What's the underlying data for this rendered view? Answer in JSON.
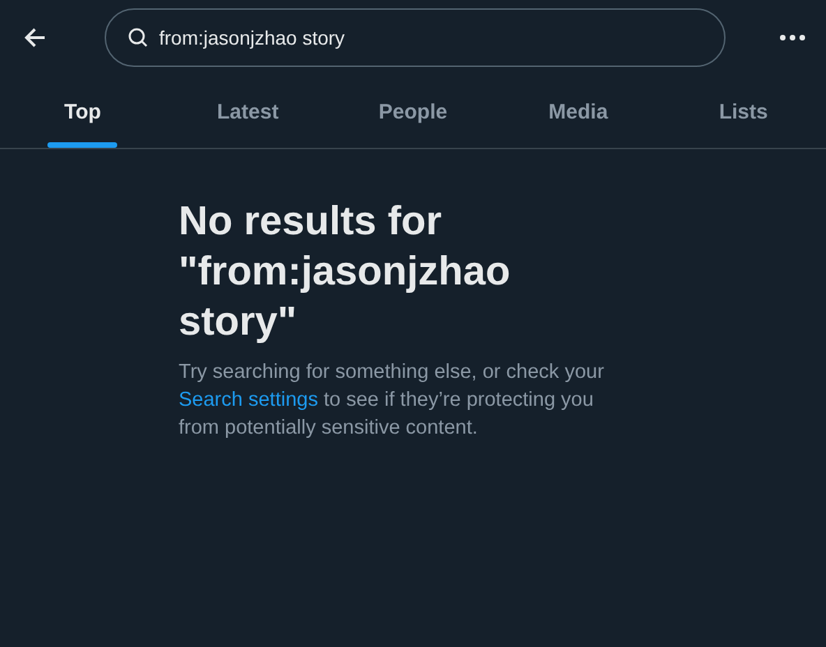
{
  "search": {
    "value": "from:jasonjzhao story"
  },
  "tabs": [
    {
      "label": "Top",
      "selected": true
    },
    {
      "label": "Latest",
      "selected": false
    },
    {
      "label": "People",
      "selected": false
    },
    {
      "label": "Media",
      "selected": false
    },
    {
      "label": "Lists",
      "selected": false
    }
  ],
  "empty_state": {
    "title": "No results for \"from:jasonjzhao story\"",
    "message_before": "Try searching for something else, or check your ",
    "link": "Search settings",
    "message_after": " to see if they’re protecting you from potentially sensitive content."
  }
}
